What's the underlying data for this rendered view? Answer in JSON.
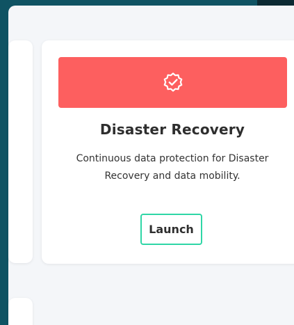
{
  "card": {
    "banner_color": "#fd5f5f",
    "icon": "verified-badge-icon",
    "title": "Disaster Recovery",
    "description_lines": [
      "Continuous data protection for Disaster",
      "Recovery and data mobility."
    ],
    "launch_label": "Launch",
    "launch_border_color": "#2fd6a6"
  }
}
